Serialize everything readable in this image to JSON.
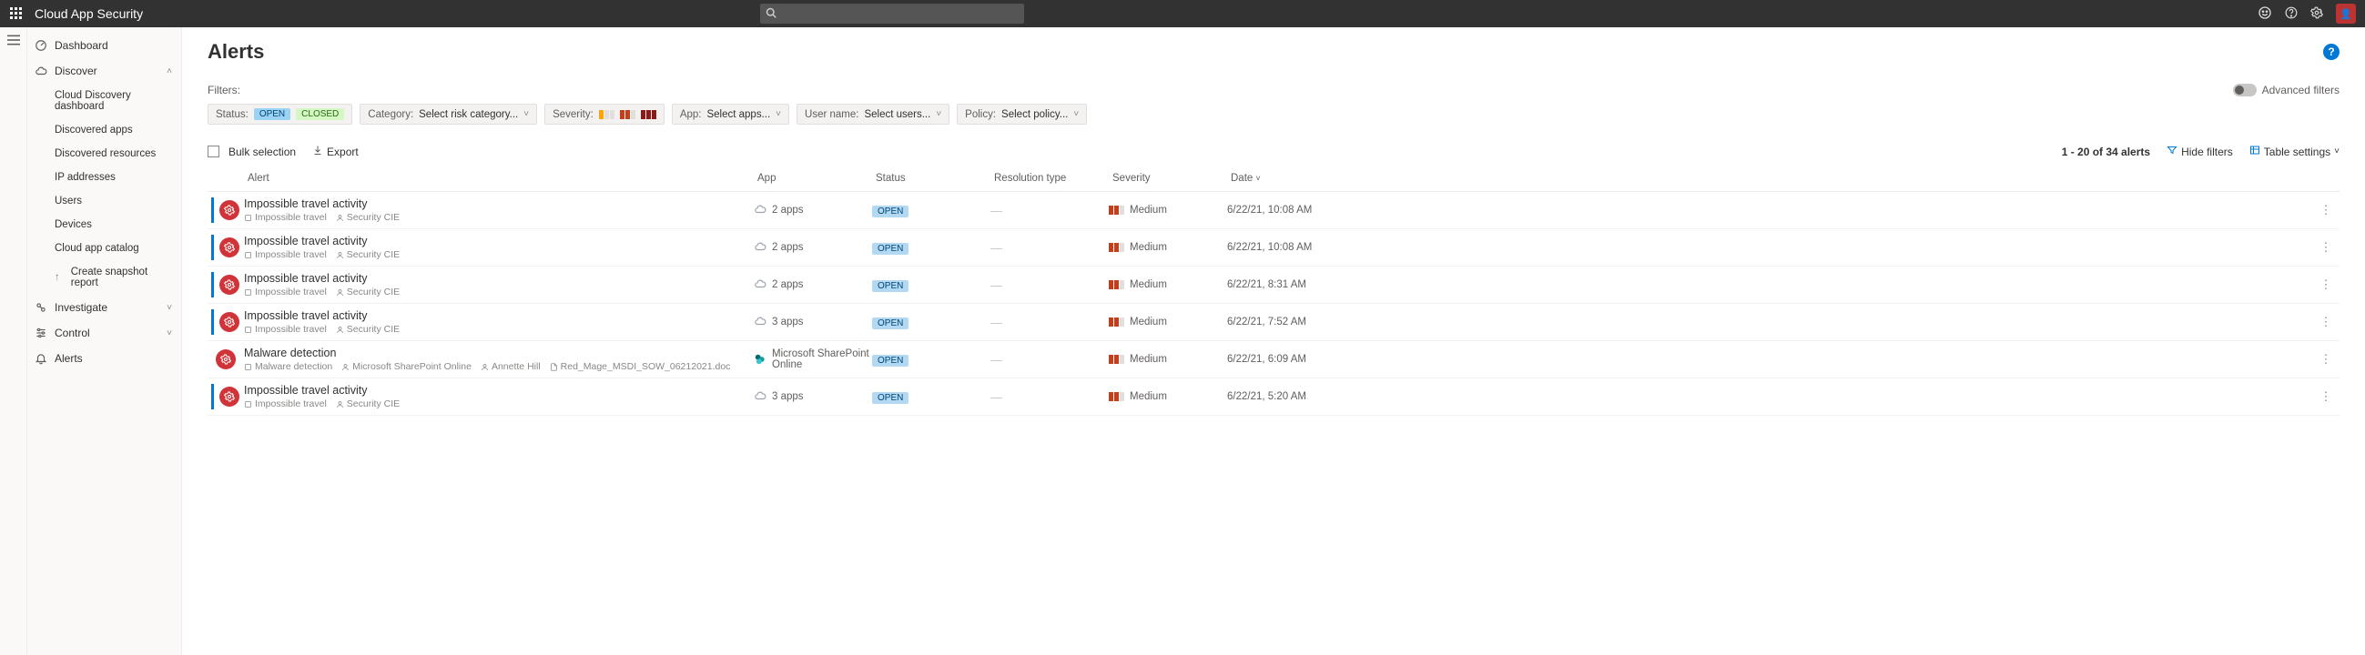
{
  "header": {
    "title": "Cloud App Security",
    "search_placeholder": ""
  },
  "sidebar": {
    "dashboard": "Dashboard",
    "discover": "Discover",
    "discover_items": [
      "Cloud Discovery dashboard",
      "Discovered apps",
      "Discovered resources",
      "IP addresses",
      "Users",
      "Devices",
      "Cloud app catalog",
      "Create snapshot report"
    ],
    "investigate": "Investigate",
    "control": "Control",
    "alerts": "Alerts"
  },
  "page": {
    "title": "Alerts",
    "filters_label": "Filters:",
    "advanced_filters": "Advanced filters"
  },
  "filters": {
    "status_label": "Status:",
    "status_open": "OPEN",
    "status_closed": "CLOSED",
    "category_label": "Category:",
    "category_value": "Select risk category...",
    "severity_label": "Severity:",
    "app_label": "App:",
    "app_value": "Select apps...",
    "username_label": "User name:",
    "username_value": "Select users...",
    "policy_label": "Policy:",
    "policy_value": "Select policy..."
  },
  "toolbar": {
    "bulk": "Bulk selection",
    "export": "Export",
    "range": "1 - 20 of 34 alerts",
    "hide_filters": "Hide filters",
    "table_settings": "Table settings"
  },
  "columns": {
    "alert": "Alert",
    "app": "App",
    "status": "Status",
    "resolution": "Resolution type",
    "severity": "Severity",
    "date": "Date"
  },
  "rows": [
    {
      "title": "Impossible travel activity",
      "sub1": "Impossible travel",
      "sub2": "Security CIE",
      "app": "2 apps",
      "app_icon": "cloud",
      "status": "OPEN",
      "severity": "Medium",
      "date": "6/22/21, 10:08 AM"
    },
    {
      "title": "Impossible travel activity",
      "sub1": "Impossible travel",
      "sub2": "Security CIE",
      "app": "2 apps",
      "app_icon": "cloud",
      "status": "OPEN",
      "severity": "Medium",
      "date": "6/22/21, 10:08 AM"
    },
    {
      "title": "Impossible travel activity",
      "sub1": "Impossible travel",
      "sub2": "Security CIE",
      "app": "2 apps",
      "app_icon": "cloud",
      "status": "OPEN",
      "severity": "Medium",
      "date": "6/22/21, 8:31 AM"
    },
    {
      "title": "Impossible travel activity",
      "sub1": "Impossible travel",
      "sub2": "Security CIE",
      "app": "3 apps",
      "app_icon": "cloud",
      "status": "OPEN",
      "severity": "Medium",
      "date": "6/22/21, 7:52 AM"
    },
    {
      "title": "Malware detection",
      "sub1": "Malware detection",
      "sub2": "Microsoft SharePoint Online",
      "sub3": "Annette Hill",
      "sub4": "Red_Mage_MSDI_SOW_06212021.doc",
      "app": "Microsoft SharePoint Online",
      "app_icon": "sharepoint",
      "status": "OPEN",
      "severity": "Medium",
      "date": "6/22/21, 6:09 AM"
    },
    {
      "title": "Impossible travel activity",
      "sub1": "Impossible travel",
      "sub2": "Security CIE",
      "app": "3 apps",
      "app_icon": "cloud",
      "status": "OPEN",
      "severity": "Medium",
      "date": "6/22/21, 5:20 AM"
    }
  ]
}
